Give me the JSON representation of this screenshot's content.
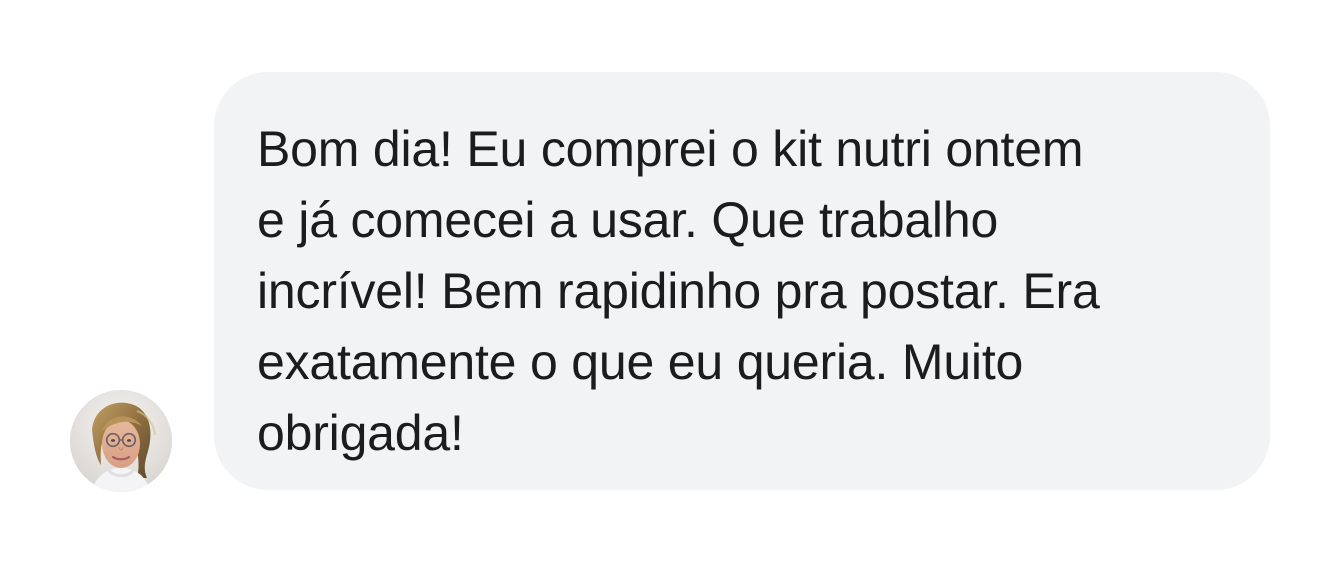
{
  "chat": {
    "sender": {
      "avatar_icon": "user-avatar-photo"
    },
    "message": {
      "lines": [
        "Bom dia! Eu comprei o kit nutri ontem",
        "e já comecei a usar. Que trabalho",
        "incrível! Bem rapidinho pra postar. Era",
        "exatamente o que eu queria. Muito",
        "obrigada!"
      ]
    }
  },
  "colors": {
    "page_background": "#ffffff",
    "bubble_background": "#f2f3f5",
    "text": "#1c1c1e"
  }
}
